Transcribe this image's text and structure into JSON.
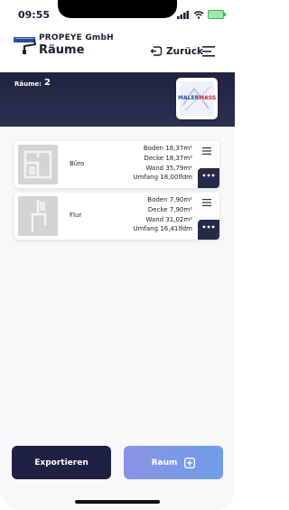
{
  "status_bar": {
    "time": "09:55"
  },
  "header": {
    "company": "PROPEYE GmbH",
    "title": "Räume",
    "back_label": "Zurück"
  },
  "banner": {
    "rooms_label": "Räume:",
    "rooms_count": "2",
    "brand_text_1": "MALER",
    "brand_text_2": "MASS"
  },
  "rooms": [
    {
      "name": "Büro",
      "metrics": [
        "Boden 18,37m²",
        "Decke 18,37m²",
        "Wand 35,79m²",
        "Umfang 18,00lfdm"
      ]
    },
    {
      "name": "Flur",
      "metrics": [
        "Boden 7,90m²",
        "Decke 7,90m²",
        "Wand 31,02m²",
        "Umfang 16,41lfdm"
      ]
    }
  ],
  "more_label": "•••",
  "buttons": {
    "export_label": "Exportieren",
    "room_label": "Raum"
  },
  "colors": {
    "dark": "#1e2142",
    "accent_gradient": "#7f97e6",
    "brand_blue": "#2a4d9b",
    "brand_red": "#d8262d"
  }
}
